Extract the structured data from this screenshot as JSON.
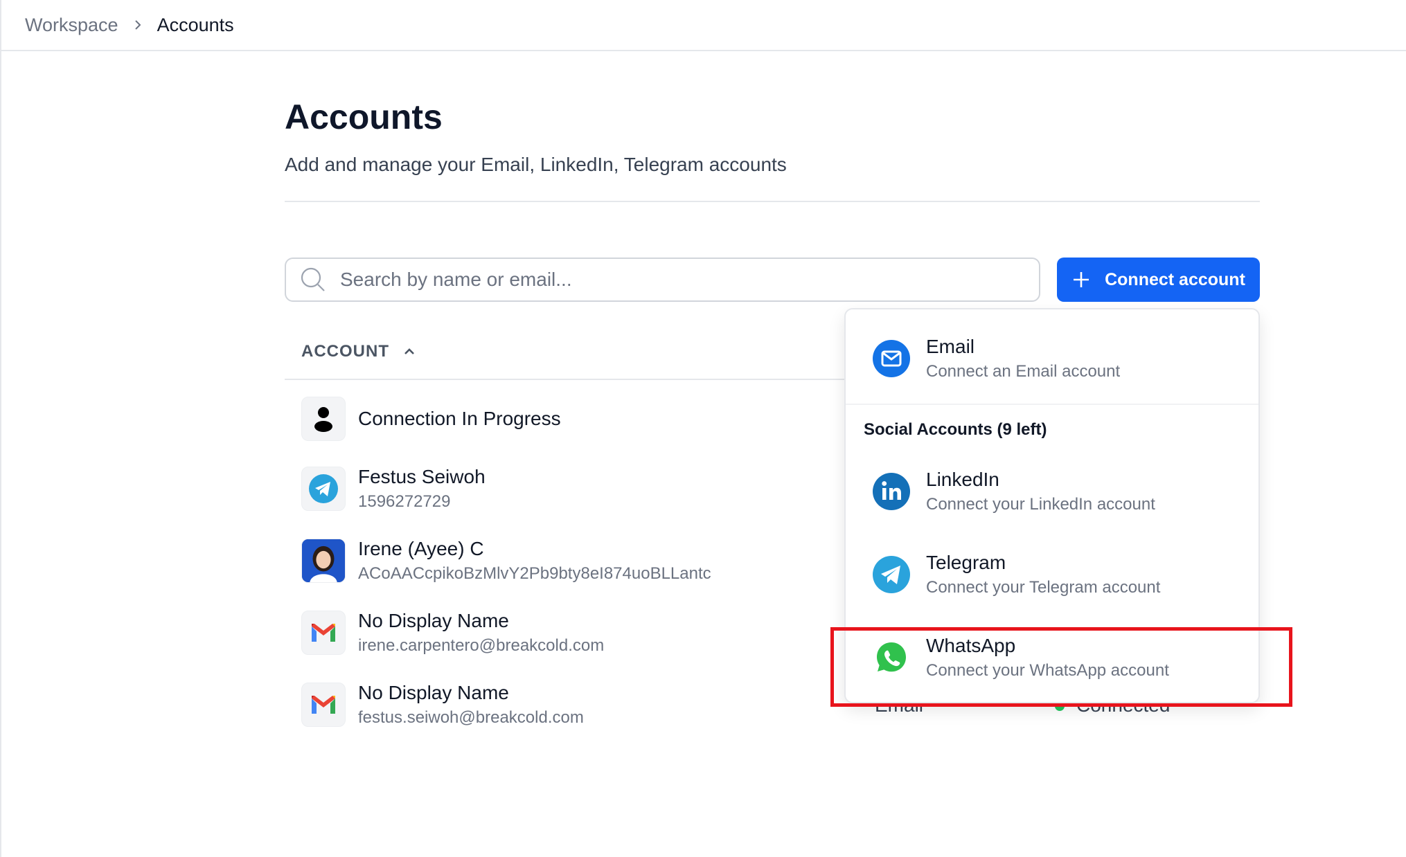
{
  "breadcrumb": {
    "root": "Workspace",
    "current": "Accounts"
  },
  "page": {
    "title": "Accounts",
    "subtitle": "Add and manage your Email, LinkedIn, Telegram accounts"
  },
  "search": {
    "placeholder": "Search by name or email..."
  },
  "connect_button": {
    "label": "Connect account",
    "color": "#1464f4"
  },
  "table": {
    "column_account": "ACCOUNT",
    "rows": [
      {
        "name": "Connection In Progress",
        "sub": "",
        "icon": "person-icon"
      },
      {
        "name": "Festus Seiwoh",
        "sub": "1596272729",
        "icon": "telegram-icon"
      },
      {
        "name": "Irene (Ayee) C",
        "sub": "ACoAACcpikoBzMlvY2Pb9bty8eI874uoBLLantc",
        "icon": "profile-photo"
      },
      {
        "name": "No Display Name",
        "sub": "irene.carpentero@breakcold.com",
        "icon": "gmail-icon"
      },
      {
        "name": "No Display Name",
        "sub": "festus.seiwoh@breakcold.com",
        "icon": "gmail-icon"
      }
    ],
    "partial_type": "Email",
    "partial_status": "Connected"
  },
  "dropdown": {
    "email": {
      "title": "Email",
      "desc": "Connect an Email account",
      "icon": "mail-icon"
    },
    "section_label": "Social Accounts (9 left)",
    "linkedin": {
      "title": "LinkedIn",
      "desc": "Connect your LinkedIn account",
      "icon": "linkedin-icon"
    },
    "telegram": {
      "title": "Telegram",
      "desc": "Connect your Telegram account",
      "icon": "telegram-icon"
    },
    "whatsapp": {
      "title": "WhatsApp",
      "desc": "Connect your WhatsApp account",
      "icon": "whatsapp-icon"
    }
  },
  "highlight_color": "#e8141c"
}
